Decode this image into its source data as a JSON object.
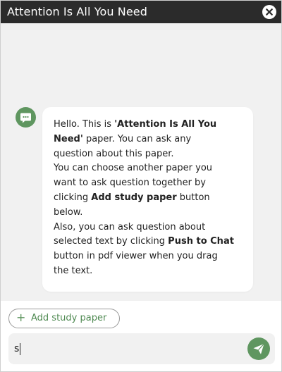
{
  "header": {
    "title": "Attention Is All You Need"
  },
  "message": {
    "lines": [
      [
        {
          "t": "Hello. This is "
        },
        {
          "t": "'Attention Is All You",
          "b": true
        }
      ],
      [
        {
          "t": "Need'",
          "b": true
        },
        {
          "t": " paper. You can ask any"
        }
      ],
      [
        {
          "t": "question about this paper."
        }
      ],
      [
        {
          "t": "You can choose another paper you"
        }
      ],
      [
        {
          "t": "want to ask question together by"
        }
      ],
      [
        {
          "t": "clicking "
        },
        {
          "t": "Add study paper",
          "b": true
        },
        {
          "t": " button"
        }
      ],
      [
        {
          "t": "below."
        }
      ],
      [
        {
          "t": "Also, you can ask question about"
        }
      ],
      [
        {
          "t": "selected text by clicking "
        },
        {
          "t": "Push to Chat",
          "b": true
        }
      ],
      [
        {
          "t": "button in pdf viewer when you drag"
        }
      ],
      [
        {
          "t": "the text."
        }
      ]
    ]
  },
  "add_paper": {
    "plus": "+",
    "label": "Add study paper"
  },
  "input": {
    "value": "s"
  },
  "icons": {
    "close": "close-icon",
    "avatar": "chat-bubble-icon",
    "send": "send-icon"
  },
  "colors": {
    "header_bg": "#2b2b2b",
    "accent": "#5f9660",
    "chat_bg": "#f1f1f1"
  }
}
